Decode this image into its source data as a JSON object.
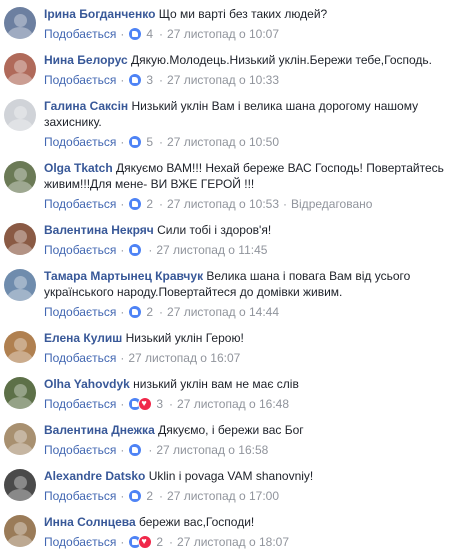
{
  "like_label": "Подобається",
  "edited_label": "Відредаговано",
  "separator": "·",
  "colors": {
    "author": "#385898",
    "meta": "#90949c",
    "like_blue": "#4e83f5",
    "love_red": "#f0284a"
  },
  "comments": [
    {
      "author": "Ірина Богданченко",
      "text": "Що ми варті без таких людей?",
      "reactions": [
        "like"
      ],
      "count": "4",
      "time": "27 листопад о 10:07",
      "avatar_color": "#6c7fa0"
    },
    {
      "author": "Нина Белорус",
      "text": "Дякую.Молодець.Низький уклін.Бережи тебе,Господь.",
      "reactions": [
        "like"
      ],
      "count": "3",
      "time": "27 листопад о 10:33",
      "avatar_color": "#b06a5a"
    },
    {
      "author": "Галина Саксін",
      "text": "Низький уклін Вам і велика шана дорогому нашому захиснику.",
      "reactions": [
        "like"
      ],
      "count": "5",
      "time": "27 листопад о 10:50",
      "avatar_color": "#d0d3d8"
    },
    {
      "author": "Olga Tkatch",
      "text": "Дякуємо ВАМ!!! Нехай береже ВАС Господь! Повертайтесь живим!!!Для мене- ВИ ВЖЕ ГЕРОЙ !!!",
      "reactions": [
        "like"
      ],
      "count": "2",
      "time": "27 листопад о 10:53",
      "edited": true,
      "avatar_color": "#6b7a56"
    },
    {
      "author": "Валентина Некряч",
      "text": "Сили тобі і здоров'я!",
      "reactions": [
        "like"
      ],
      "count": "",
      "time": "27 листопад о 11:45",
      "avatar_color": "#8a5a44"
    },
    {
      "author": "Тамара Мартынец Кравчук",
      "text": "Велика шана і повага Вам від усього українського народу.Повертайтеся до домівки живим.",
      "reactions": [
        "like"
      ],
      "count": "2",
      "time": "27 листопад о 14:44",
      "avatar_color": "#6f8cad"
    },
    {
      "author": "Елена Кулиш",
      "text": "Низький уклін Герою!",
      "reactions": [],
      "count": "",
      "time": "27 листопад о 16:07",
      "avatar_color": "#b08050"
    },
    {
      "author": "Olha Yahovdyk",
      "text": "низький уклін вам не має слів",
      "reactions": [
        "like",
        "love"
      ],
      "count": "3",
      "time": "27 листопад о 16:48",
      "avatar_color": "#5d7048"
    },
    {
      "author": "Валентина Днежка",
      "text": "Дякуємо, і бережи вас Бог",
      "reactions": [
        "like"
      ],
      "count": "",
      "time": "27 листопад о 16:58",
      "avatar_color": "#a89070"
    },
    {
      "author": "Alexandre Datsko",
      "text": "Uklin i povaga VAM shanovniy!",
      "reactions": [
        "like"
      ],
      "count": "2",
      "time": "27 листопад о 17:00",
      "avatar_color": "#4a4a4a"
    },
    {
      "author": "Инна Солнцева",
      "text": "бережи вас,Господи!",
      "reactions": [
        "like",
        "love"
      ],
      "count": "2",
      "time": "27 листопад о 18:07",
      "avatar_color": "#9a7b58"
    }
  ]
}
